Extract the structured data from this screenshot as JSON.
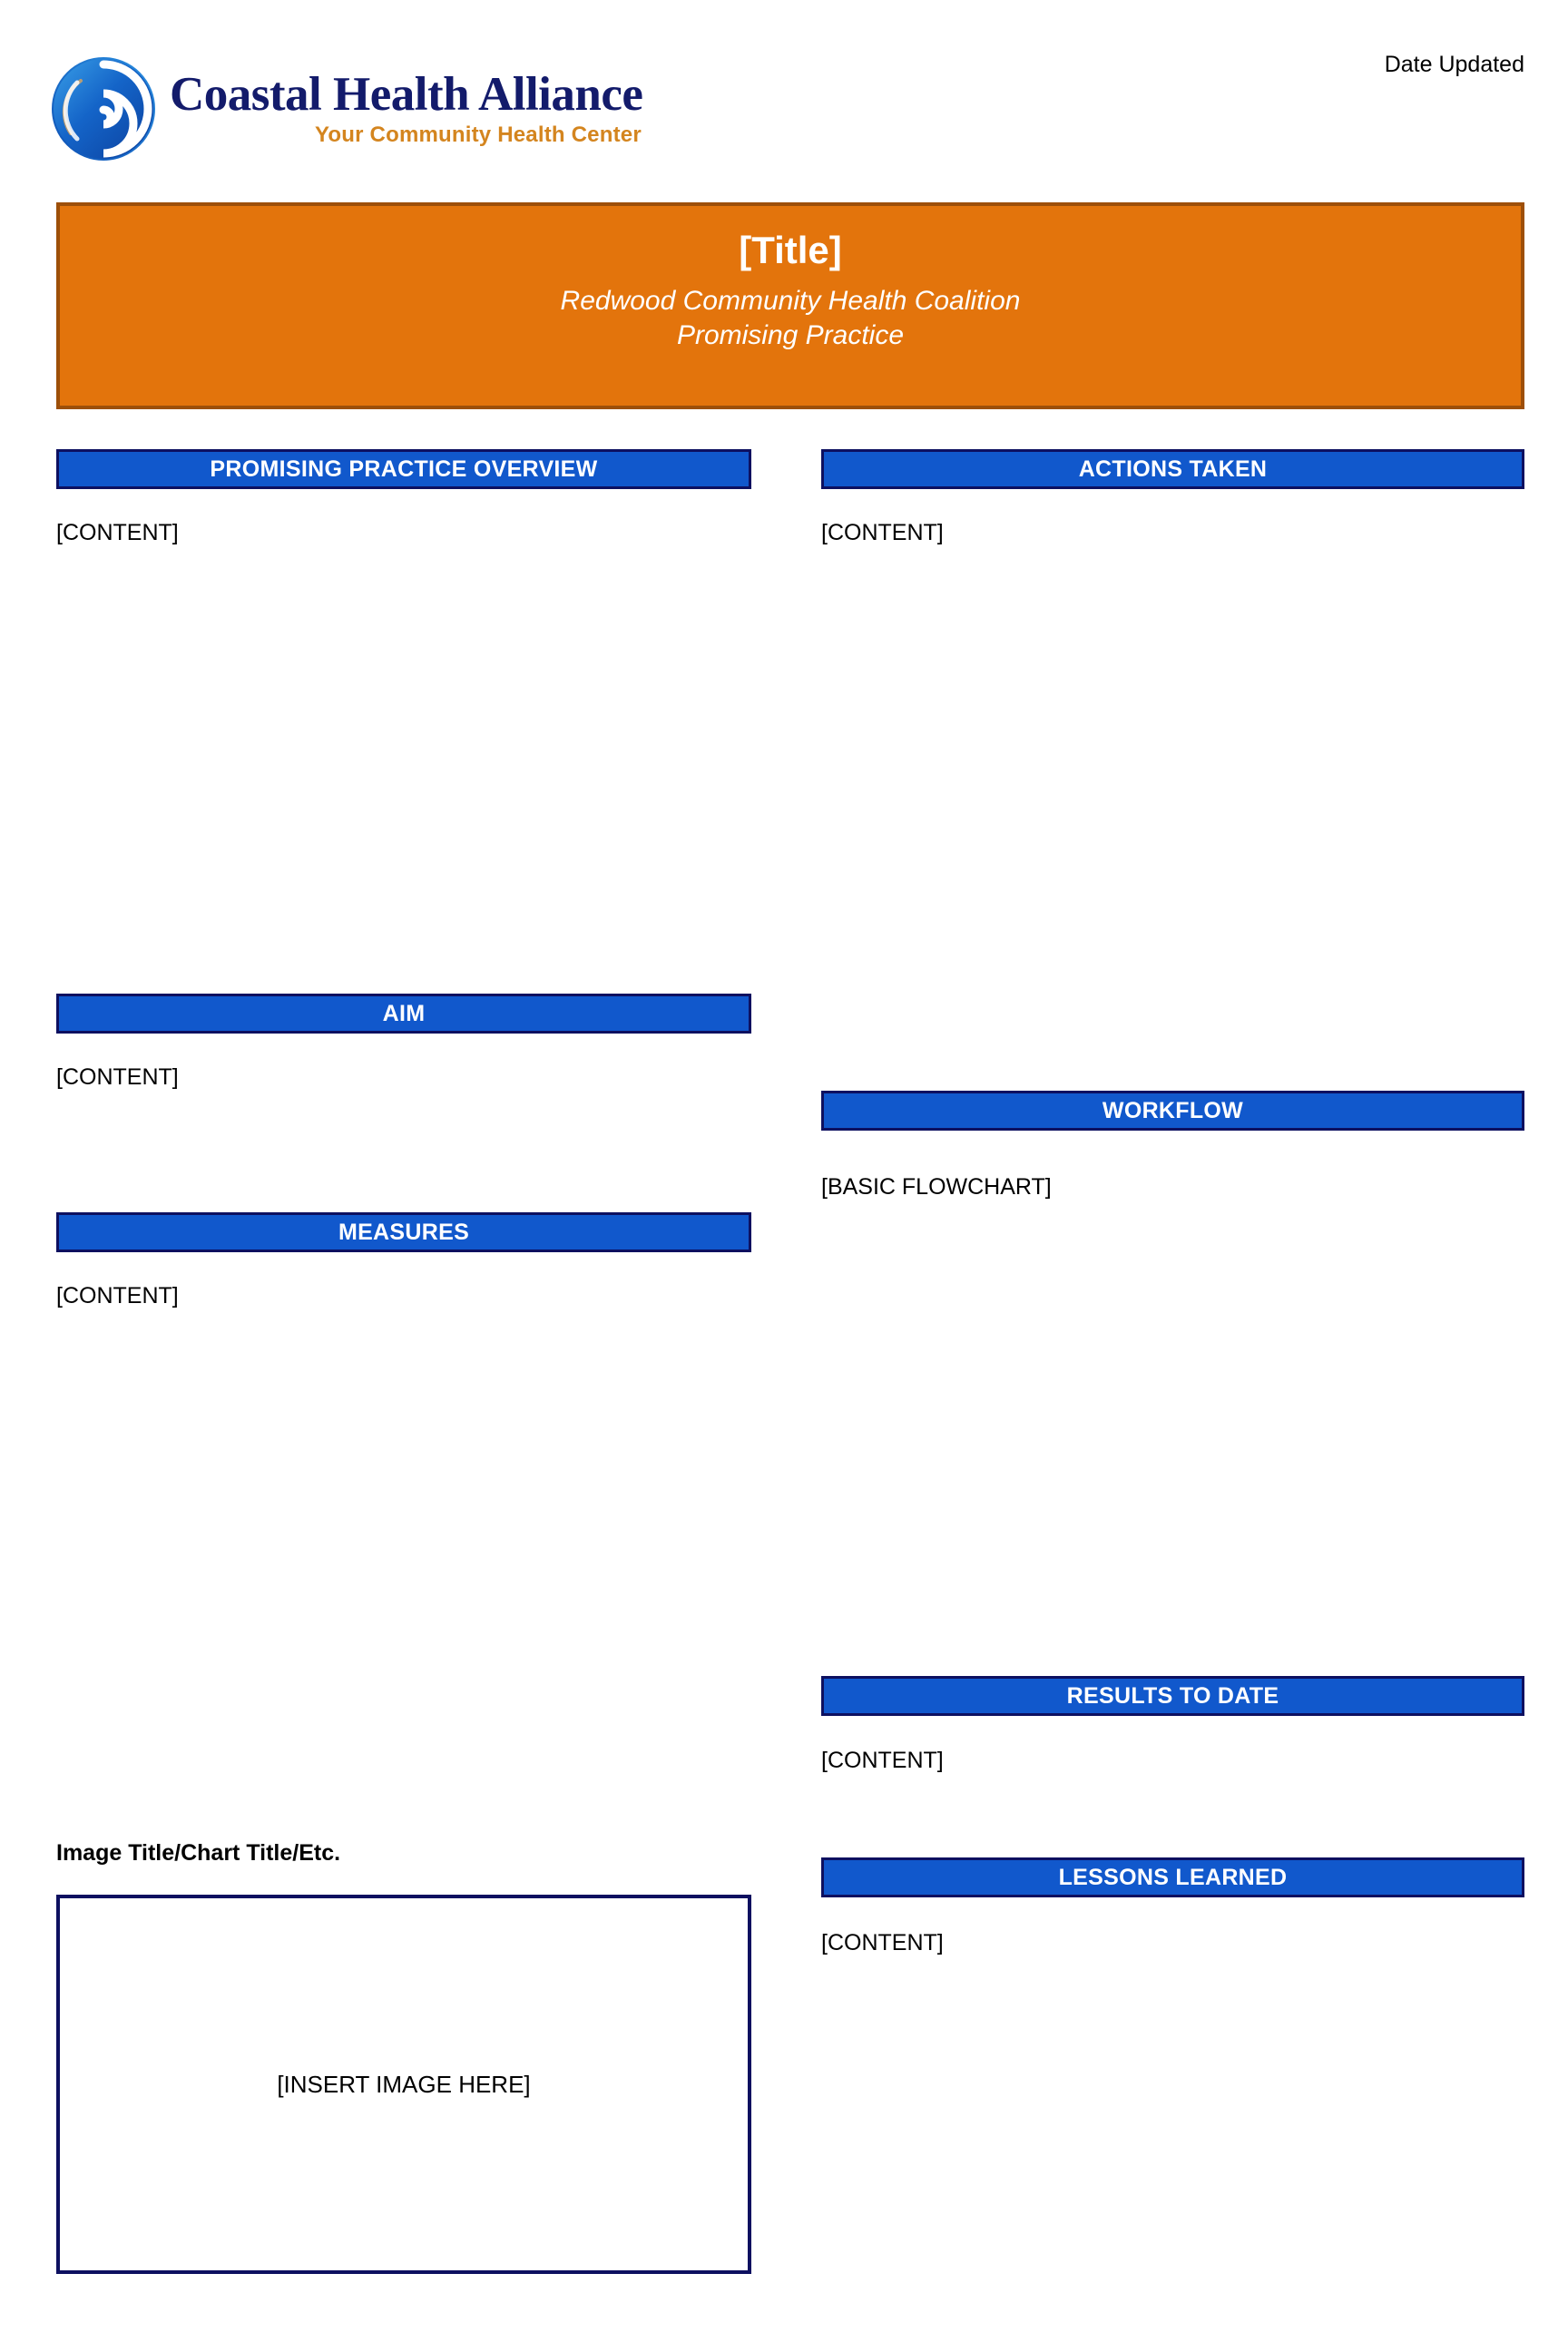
{
  "header": {
    "logo": {
      "name": "Coastal Health Alliance",
      "tagline": "Your Community Health Center",
      "mark_icon": "wave-spiral-icon",
      "name_color": "#131b6b",
      "tagline_color": "#d4851f"
    },
    "date_updated_label": "Date Updated"
  },
  "banner": {
    "title": "[Title]",
    "subtitle_line1": "Redwood Community Health Coalition",
    "subtitle_line2": "Promising Practice",
    "fill_color": "#E3740C",
    "border_color": "#9d4f09",
    "text_color": "#ffffff"
  },
  "theme": {
    "section_bar_fill": "#1158cc",
    "section_bar_border": "#0d1060",
    "section_bar_text": "#ffffff",
    "body_text": "#000000",
    "page_background": "#ffffff"
  },
  "left_column": {
    "sections": [
      {
        "heading": "PROMISING PRACTICE OVERVIEW",
        "body": "[CONTENT]"
      },
      {
        "heading": "AIM",
        "body": "[CONTENT]"
      },
      {
        "heading": "MEASURES",
        "body": "[CONTENT]"
      }
    ],
    "image_block": {
      "caption": "Image Title/Chart Title/Etc.",
      "placeholder_label": "[INSERT IMAGE HERE]"
    }
  },
  "right_column": {
    "sections": [
      {
        "heading": "ACTIONS TAKEN",
        "body": "[CONTENT]"
      },
      {
        "heading": "WORKFLOW",
        "body": "[BASIC FLOWCHART]"
      },
      {
        "heading": "RESULTS TO DATE",
        "body": "[CONTENT]"
      },
      {
        "heading": "LESSONS LEARNED",
        "body": "[CONTENT]"
      }
    ]
  }
}
